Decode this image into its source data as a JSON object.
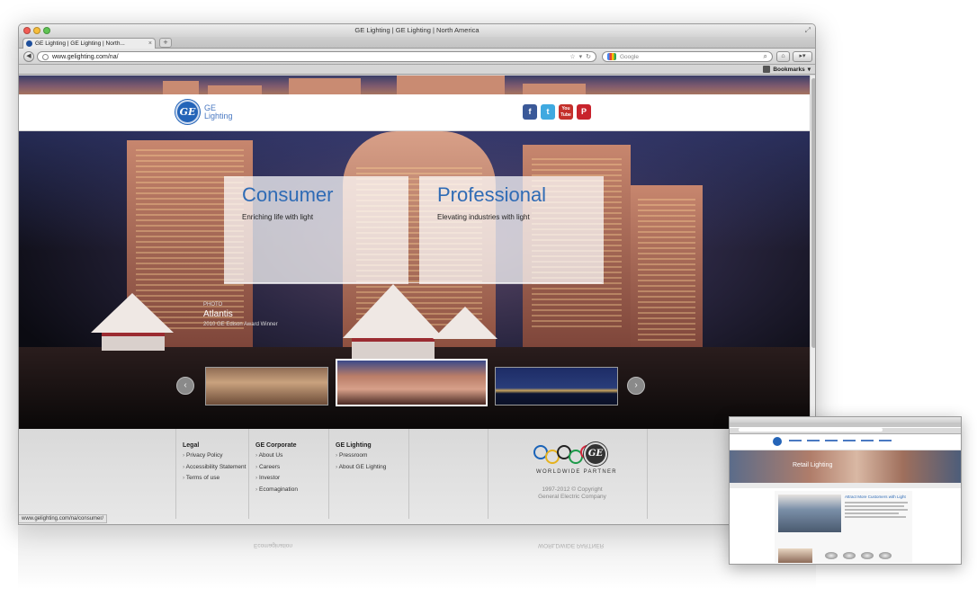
{
  "browser": {
    "window_title": "GE Lighting | GE Lighting | North America",
    "tab_title": "GE Lighting | GE Lighting | North...",
    "url": "www.gelighting.com/na/",
    "search_placeholder": "Google",
    "bookmarks_label": "Bookmarks",
    "status_url": "www.gelighting.com/na/consumer/"
  },
  "header": {
    "logo_text": "GE",
    "brand_line1": "GE",
    "brand_line2": "Lighting",
    "social": [
      {
        "name": "Facebook",
        "glyph": "f"
      },
      {
        "name": "Twitter",
        "glyph": "t"
      },
      {
        "name": "YouTube",
        "glyph": "You Tube"
      },
      {
        "name": "Pinterest",
        "glyph": "P"
      }
    ]
  },
  "hero": {
    "cards": [
      {
        "title": "Consumer",
        "subtitle": "Enriching life with light"
      },
      {
        "title": "Professional",
        "subtitle": "Elevating industries with light"
      }
    ],
    "photo_label": "PHOTO",
    "photo_name": "Atlantis",
    "photo_award": "2010 GE Edison Award Winner",
    "prev_glyph": "‹",
    "next_glyph": "›"
  },
  "footer": {
    "columns": [
      {
        "heading": "Legal",
        "links": [
          "Privacy Policy",
          "Accessibility Statement",
          "Terms of use"
        ]
      },
      {
        "heading": "GE Corporate",
        "links": [
          "About Us",
          "Careers",
          "Investor",
          "Ecomagination"
        ]
      },
      {
        "heading": "GE Lighting",
        "links": [
          "Pressroom",
          "About GE Lighting"
        ]
      }
    ],
    "partner_label": "WORLDWIDE PARTNER",
    "copyright_line1": "1997-2012 © Copyright",
    "copyright_line2": "General Electric Company",
    "ring_colors": [
      "#1a63b8",
      "#e5b21e",
      "#222222",
      "#1d9a4a",
      "#d7263d"
    ]
  },
  "mini_window": {
    "hero_text": "Retail Lighting",
    "headline": "Attract More Customers with Light"
  },
  "colors": {
    "brand_blue": "#2f6bb5",
    "ge_blue": "#2464b8"
  }
}
